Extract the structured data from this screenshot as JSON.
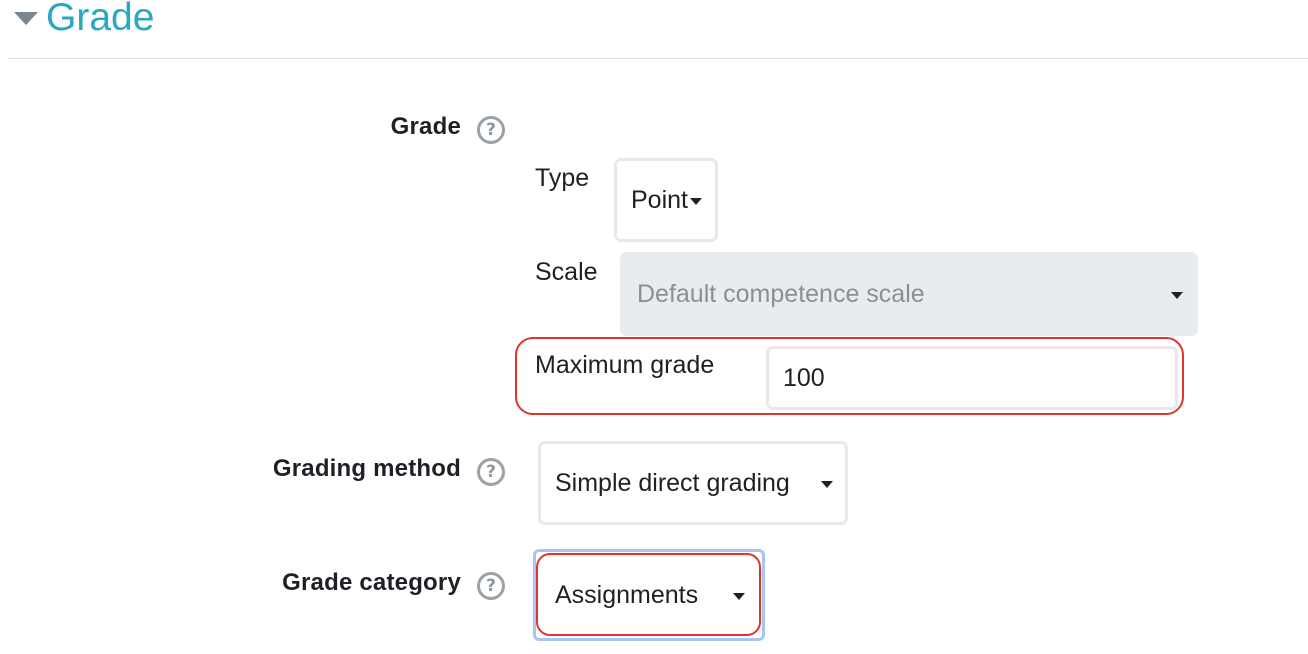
{
  "section": {
    "title": "Grade",
    "expanded": true
  },
  "grade": {
    "label": "Grade",
    "help_icon": "question-circle-icon",
    "type": {
      "label": "Type",
      "value": "Point"
    },
    "scale": {
      "label": "Scale",
      "value": "Default competence scale",
      "disabled": true
    },
    "maximum_grade": {
      "label": "Maximum grade",
      "value": "100"
    }
  },
  "grading_method": {
    "label": "Grading method",
    "help_icon": "question-circle-icon",
    "value": "Simple direct grading"
  },
  "grade_category": {
    "label": "Grade category",
    "help_icon": "question-circle-icon",
    "value": "Assignments"
  },
  "colors": {
    "section_title": "#2aa7c3",
    "highlight": "#e0342e",
    "focus_ring": "#a9c7ee",
    "disabled_bg": "#e9ecef"
  }
}
